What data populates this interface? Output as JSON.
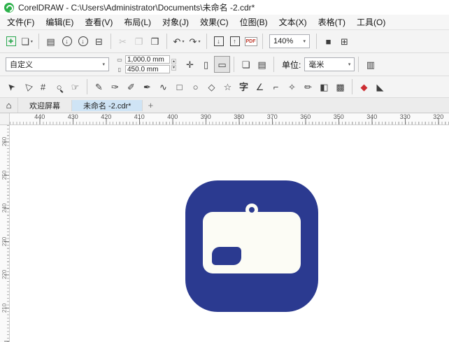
{
  "titlebar": {
    "title": "CorelDRAW - C:\\Users\\Administrator\\Documents\\未命名 -2.cdr*"
  },
  "menubar": {
    "items": [
      {
        "name": "menu-file",
        "label": "文件(F)"
      },
      {
        "name": "menu-edit",
        "label": "编辑(E)"
      },
      {
        "name": "menu-view",
        "label": "查看(V)"
      },
      {
        "name": "menu-layout",
        "label": "布局(L)"
      },
      {
        "name": "menu-object",
        "label": "对象(J)"
      },
      {
        "name": "menu-effects",
        "label": "效果(C)"
      },
      {
        "name": "menu-bitmaps",
        "label": "位图(B)"
      },
      {
        "name": "menu-text",
        "label": "文本(X)"
      },
      {
        "name": "menu-table",
        "label": "表格(T)"
      },
      {
        "name": "menu-tools",
        "label": "工具(O)"
      }
    ]
  },
  "toolbar": {
    "groups": [
      {
        "items": [
          {
            "name": "new-document-button",
            "glyph": "✚",
            "cls": "boxed green"
          },
          {
            "name": "open-button",
            "glyph": "❏",
            "caret": "▾"
          }
        ]
      },
      {
        "items": [
          {
            "name": "save-button",
            "glyph": "▤"
          },
          {
            "name": "cloud-download-button",
            "glyph": "↓",
            "cls": "circled"
          },
          {
            "name": "cloud-upload-button",
            "glyph": "↓",
            "cls": "circled"
          },
          {
            "name": "print-button",
            "glyph": "⊟"
          }
        ]
      },
      {
        "items": [
          {
            "name": "cut-button",
            "glyph": "✂",
            "cls": "disabled"
          },
          {
            "name": "copy-button",
            "glyph": "❐",
            "cls": "disabled"
          },
          {
            "name": "paste-button",
            "glyph": "❒"
          }
        ]
      },
      {
        "items": [
          {
            "name": "undo-button",
            "glyph": "↶",
            "caret": "▾"
          },
          {
            "name": "redo-button",
            "glyph": "↷",
            "caret": "▾"
          }
        ]
      },
      {
        "items": [
          {
            "name": "import-button",
            "glyph": "↓",
            "cls": "boxed"
          },
          {
            "name": "export-button",
            "glyph": "↑",
            "cls": "boxed"
          },
          {
            "name": "publish-pdf-button",
            "glyph": "PDF",
            "cls": "pdf"
          }
        ]
      },
      {
        "items": [
          {
            "name": "fullscreen-preview-button",
            "glyph": "■"
          },
          {
            "name": "show-rulers-button",
            "glyph": "⊞"
          }
        ]
      }
    ],
    "zoom": {
      "value": "140%",
      "caret": "▾"
    }
  },
  "propbar": {
    "page_size": {
      "value": "自定义",
      "caret": "▾"
    },
    "dims": {
      "width": "1,000.0 mm",
      "height": "450.0 mm",
      "width_icon": "▭",
      "height_icon": "▯",
      "spin_up": "▴",
      "spin_down": "▾"
    },
    "nudge": {
      "glyph": "✛"
    },
    "orientation": [
      {
        "name": "portrait-button",
        "glyph": "▯"
      },
      {
        "name": "landscape-button",
        "glyph": "▭",
        "cls": "active"
      }
    ],
    "page_buttons": [
      {
        "name": "all-pages-button",
        "glyph": "❏"
      },
      {
        "name": "current-page-button",
        "glyph": "▤"
      }
    ],
    "units": {
      "label": "单位:",
      "value": "毫米",
      "caret": "▾"
    },
    "options_button": {
      "glyph": "▥"
    }
  },
  "toolbox": {
    "groups": [
      {
        "tools": [
          {
            "name": "pick-tool",
            "glyph": "➤",
            "cls": "rot-nw"
          },
          {
            "name": "shape-tool",
            "glyph": "▷",
            "cls": "rot-nw"
          },
          {
            "name": "crop-tool",
            "glyph": "#"
          },
          {
            "name": "zoom-tool",
            "glyph": "○",
            "cls": "zoomglass"
          },
          {
            "name": "pan-tool",
            "glyph": "☞"
          }
        ]
      },
      {
        "tools": [
          {
            "name": "freehand-tool",
            "glyph": "✎"
          },
          {
            "name": "bezier-tool",
            "glyph": "✑"
          },
          {
            "name": "artistic-media-tool",
            "glyph": "✐"
          },
          {
            "name": "pen-tool",
            "glyph": "✒"
          },
          {
            "name": "polyline-tool",
            "glyph": "∿"
          },
          {
            "name": "rectangle-tool",
            "glyph": "□"
          },
          {
            "name": "ellipse-tool",
            "glyph": "○"
          },
          {
            "name": "polygon-tool",
            "glyph": "◇"
          },
          {
            "name": "common-shapes-tool",
            "glyph": "☆"
          },
          {
            "name": "text-tool",
            "glyph": "字",
            "cls": "text"
          },
          {
            "name": "dimension-tool",
            "glyph": "∠"
          },
          {
            "name": "connector-tool",
            "glyph": "⌐"
          },
          {
            "name": "eyedropper-tool",
            "glyph": "✧"
          },
          {
            "name": "outline-pen-tool",
            "glyph": "✏"
          },
          {
            "name": "fill-tool",
            "glyph": "◧"
          },
          {
            "name": "transparency-tool",
            "glyph": "▩"
          }
        ]
      },
      {
        "tools": [
          {
            "name": "smart-fill-tool",
            "glyph": "◆",
            "cls": "red"
          },
          {
            "name": "interactive-fill-tool",
            "glyph": "◣"
          }
        ]
      }
    ]
  },
  "tabbar": {
    "home_glyph": "⌂",
    "tabs": [
      {
        "name": "tab-welcome-screen",
        "label": "欢迎屏幕",
        "cls": ""
      },
      {
        "name": "tab-untitled-2",
        "label": "未命名 -2.cdr*",
        "cls": "active"
      }
    ],
    "new_tab_label": "+",
    "active_color": "#cfe4f5"
  },
  "rulers": {
    "horizontal": [
      "440",
      "430",
      "420",
      "410",
      "400",
      "390",
      "380",
      "370",
      "360",
      "350",
      "340",
      "330",
      "320"
    ],
    "vertical": [
      "260",
      "250",
      "240",
      "230",
      "220",
      "210"
    ]
  },
  "canvas": {
    "artwork": {
      "description": "blue rounded-square badge icon with white card, hanger hole and small blue eraser shape",
      "outer_color": "#2b3a90",
      "card_color": "#fcfcf5"
    }
  }
}
